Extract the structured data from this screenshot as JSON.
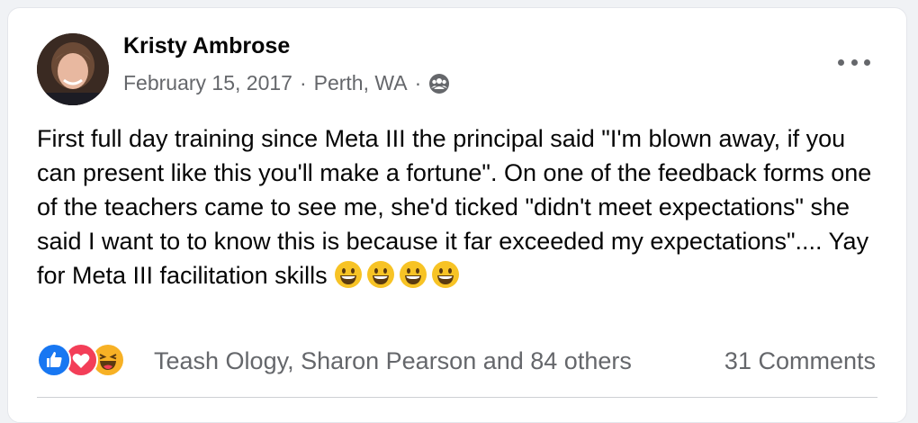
{
  "post": {
    "author": "Kristy Ambrose",
    "date": "February 15, 2017",
    "separator1": "·",
    "location": "Perth, WA",
    "separator2": "·",
    "privacy_icon": "friends-icon",
    "text": "First full day training since Meta III the principal said \"I'm blown away, if you can present like this you'll make a fortune\". On one of the feedback forms one of the teachers came to see me, she'd ticked \"didn't meet expectations\" she said I want to to know this is because it far exceeded my expectations\".... Yay for Meta III facilitation skills",
    "emojis": [
      "grinning-emoji",
      "grinning-emoji",
      "grinning-emoji",
      "grinning-emoji"
    ]
  },
  "reactions": {
    "icons": [
      "like-icon",
      "love-icon",
      "haha-icon"
    ],
    "names": "Teash Ology, Sharon Pearson and 84 others",
    "comments": "31 Comments"
  },
  "colors": {
    "like": "#1877f2",
    "love": "#f33e58",
    "haha": "#f7b125",
    "meta_text": "#65676b"
  }
}
